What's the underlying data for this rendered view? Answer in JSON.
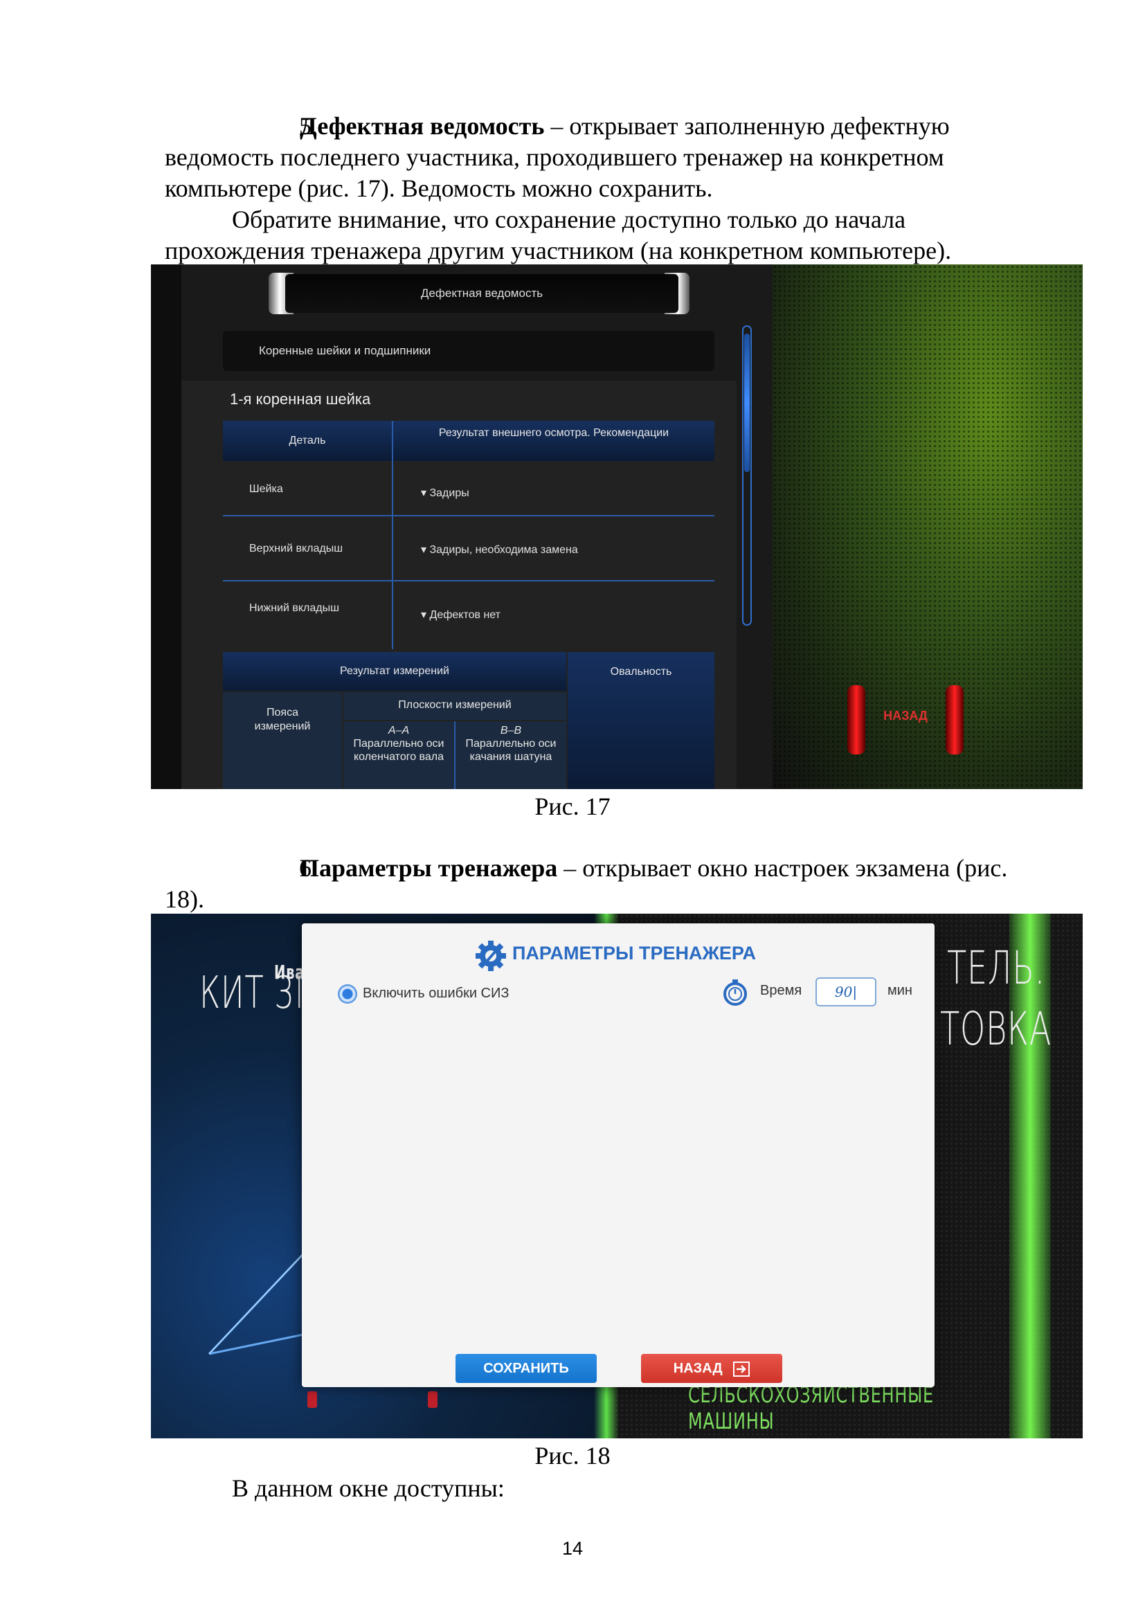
{
  "text": {
    "p1_num": "5.",
    "p1_bold": "Дефектная ведомость",
    "p1_rest": " – открывает заполненную дефектную ведомость последнего участника, проходившего тренажер на конкретном компьютере (рис. 17). Ведомость можно сохранить.",
    "p2": "Обратите внимание, что сохранение доступно только до начала прохождения тренажера другим участником (на конкретном компьютере).",
    "caption17": "Рис. 17",
    "p3_num": "6.",
    "p3_bold": "Параметры тренажера",
    "p3_rest": " – открывает окно настроек экзамена (рис. 18).",
    "caption18": "Рис. 18",
    "p4": "В данном окне доступны:",
    "page_number": "14"
  },
  "fig17": {
    "window_title": "Дефектная ведомость",
    "section_label": "Коренные шейки и подшипники",
    "card_title": "1-я коренная шейка",
    "table1": {
      "col1_header": "Деталь",
      "col2_header": "Результат внешнего осмотра. Рекомендации",
      "rows": [
        {
          "part": "Шейка",
          "result": "Задиры"
        },
        {
          "part": "Верхний вкладыш",
          "result": "Задиры, необходима замена"
        },
        {
          "part": "Нижний вкладыш",
          "result": "Дефектов нет"
        }
      ]
    },
    "table2": {
      "measure_header": "Результат измерений",
      "ovality_header": "Овальность",
      "belts_header": "Пояса измерений",
      "planes_header": "Плоскости измерений",
      "plane_aa_title": "А–А",
      "plane_aa_desc": "Параллельно оси коленчатого вала",
      "plane_bb_title": "В–В",
      "plane_bb_desc": "Параллельно оси качания шатуна"
    },
    "back_label": "НАЗАД",
    "colors": {
      "accent_blue": "#2b5ba8",
      "back_red": "#e03030",
      "green_bg": "#5d8a1a"
    }
  },
  "fig18": {
    "bg_text_1": "КИТ 3І",
    "bg_text_2": "Ива",
    "bg_text_3": "ТЕЛЬ.",
    "bg_text_4": "ТОВКА",
    "bg_text_green": "СЕЛЬСКОХОЗЯЙСТВЕННЫЕ МАШИНЫ",
    "dialog_title": "ПАРАМЕТРЫ ТРЕНАЖЕРА",
    "radio_label": "Включить ошибки СИЗ",
    "time_label": "Время",
    "time_value": "90|",
    "time_unit": "мин",
    "save_label": "СОХРАНИТЬ",
    "back_label": "НАЗАД",
    "icons": {
      "title": "gear-wrench-icon",
      "time": "stopwatch-icon",
      "back": "exit-icon"
    },
    "colors": {
      "title_blue": "#2a6bc2",
      "save_blue": "#1f80d8",
      "back_red": "#d93e34"
    }
  }
}
